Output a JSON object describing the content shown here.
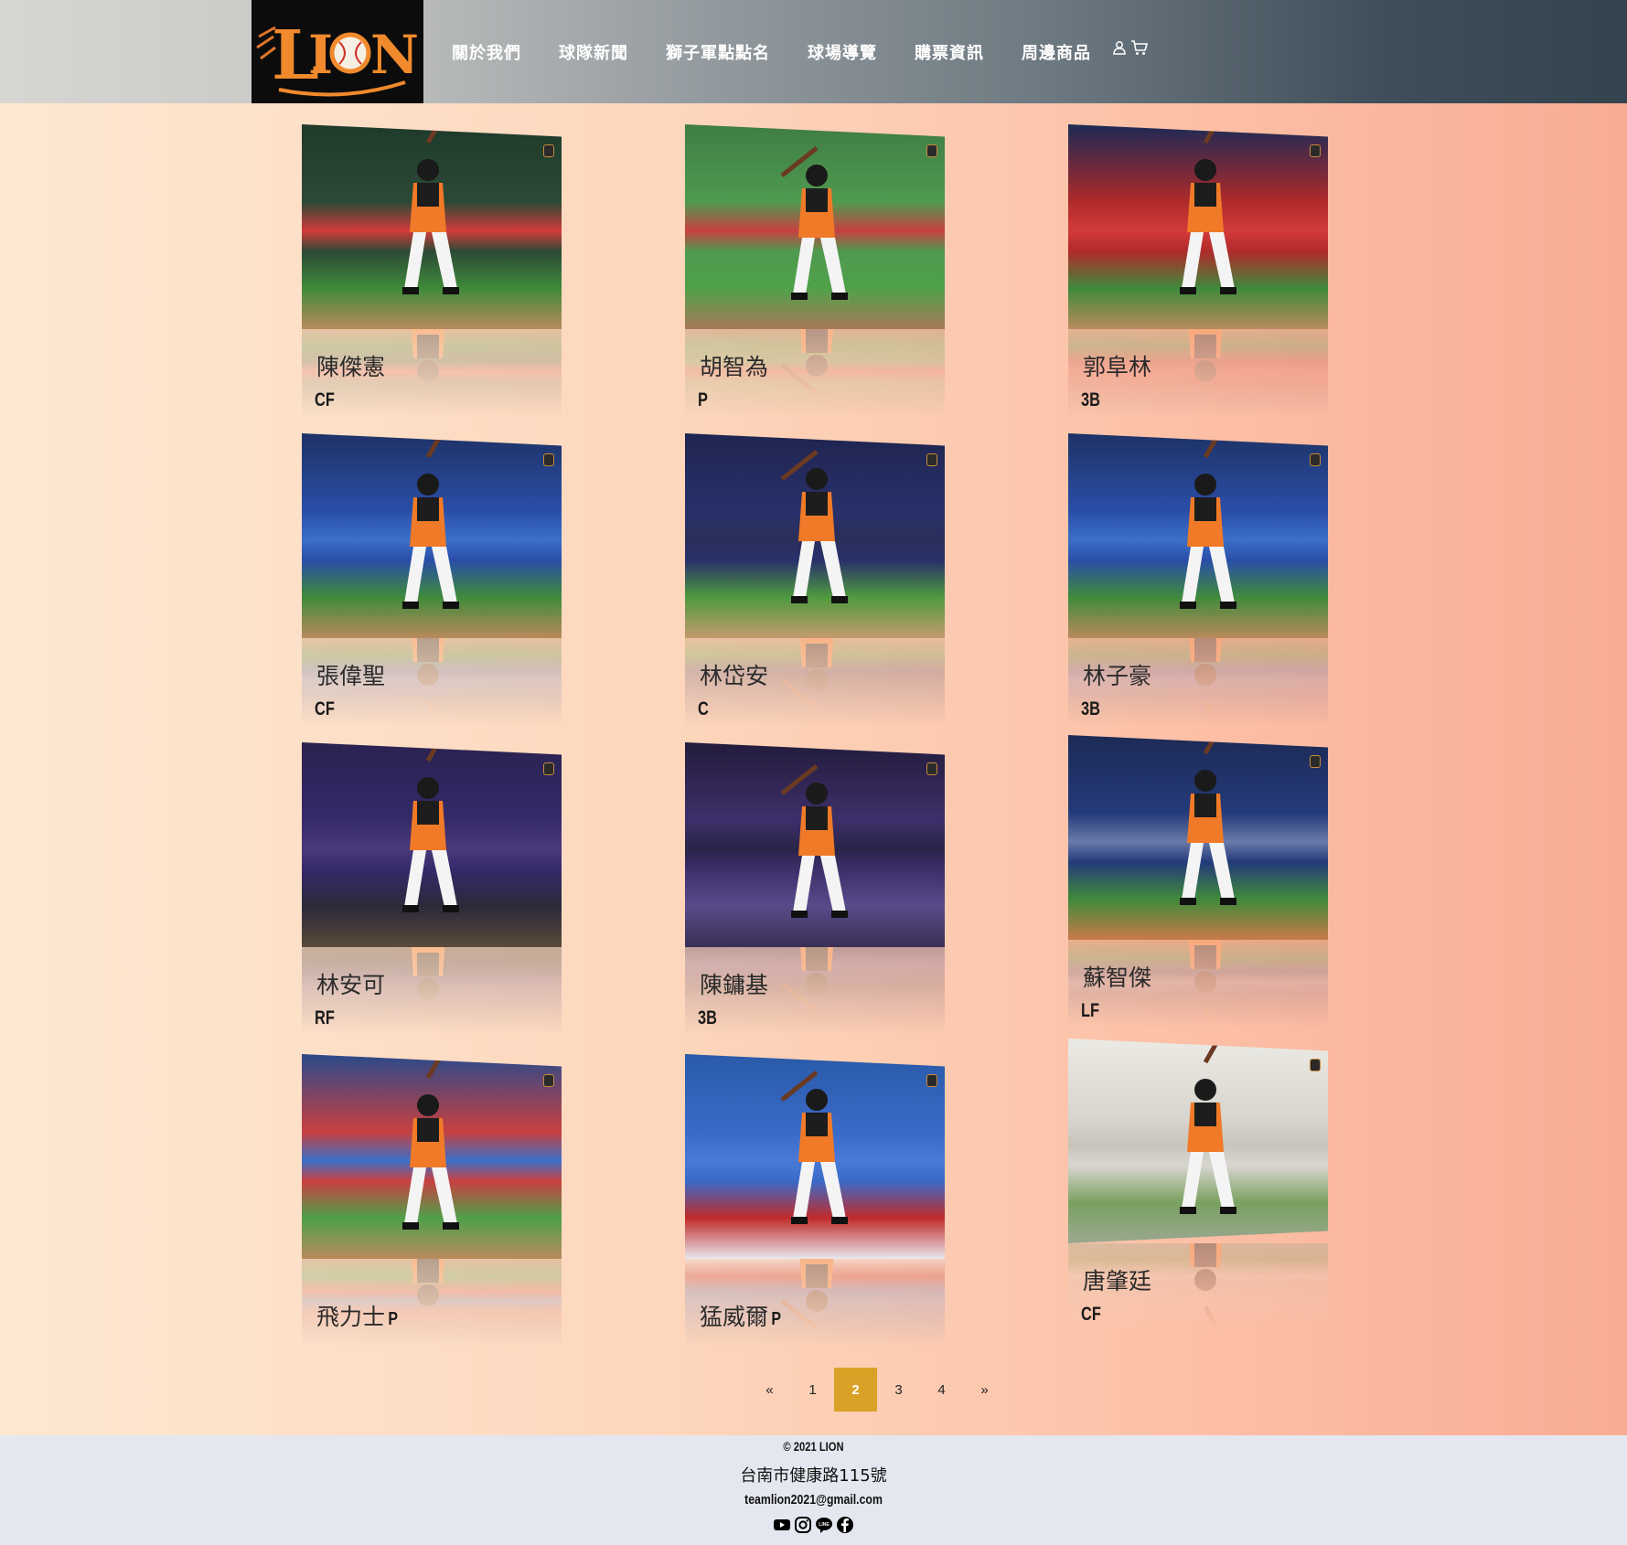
{
  "brand": {
    "logo_text": "LION",
    "accent": "#f07a28"
  },
  "nav": {
    "items": [
      {
        "label": "關於我們"
      },
      {
        "label": "球隊新聞"
      },
      {
        "label": "獅子軍點點名"
      },
      {
        "label": "球場導覽"
      },
      {
        "label": "購票資訊"
      },
      {
        "label": "周邊商品"
      }
    ],
    "icons": [
      "user-icon",
      "cart-icon"
    ]
  },
  "players": [
    {
      "name": "陳傑憲",
      "position": "CF"
    },
    {
      "name": "胡智為",
      "position": "P"
    },
    {
      "name": "郭阜林",
      "position": "3B"
    },
    {
      "name": "張偉聖",
      "position": "CF"
    },
    {
      "name": "林岱安",
      "position": "C"
    },
    {
      "name": "林子豪",
      "position": "3B"
    },
    {
      "name": "林安可",
      "position": "RF"
    },
    {
      "name": "陳鏞基",
      "position": "3B"
    },
    {
      "name": "蘇智傑",
      "position": "LF"
    },
    {
      "name": "飛力士",
      "position": "P"
    },
    {
      "name": "猛威爾",
      "position": "P"
    },
    {
      "name": "唐肇廷",
      "position": "CF"
    }
  ],
  "pagination": {
    "prev": "«",
    "pages": [
      "1",
      "2",
      "3",
      "4"
    ],
    "current": "2",
    "next": "»",
    "active_color": "#d9a227"
  },
  "footer": {
    "copyright": "© 2021 LION",
    "address": "台南市健康路115號",
    "email": "teamlion2021@gmail.com",
    "socials": [
      "youtube-icon",
      "instagram-icon",
      "line-icon",
      "facebook-icon"
    ]
  }
}
